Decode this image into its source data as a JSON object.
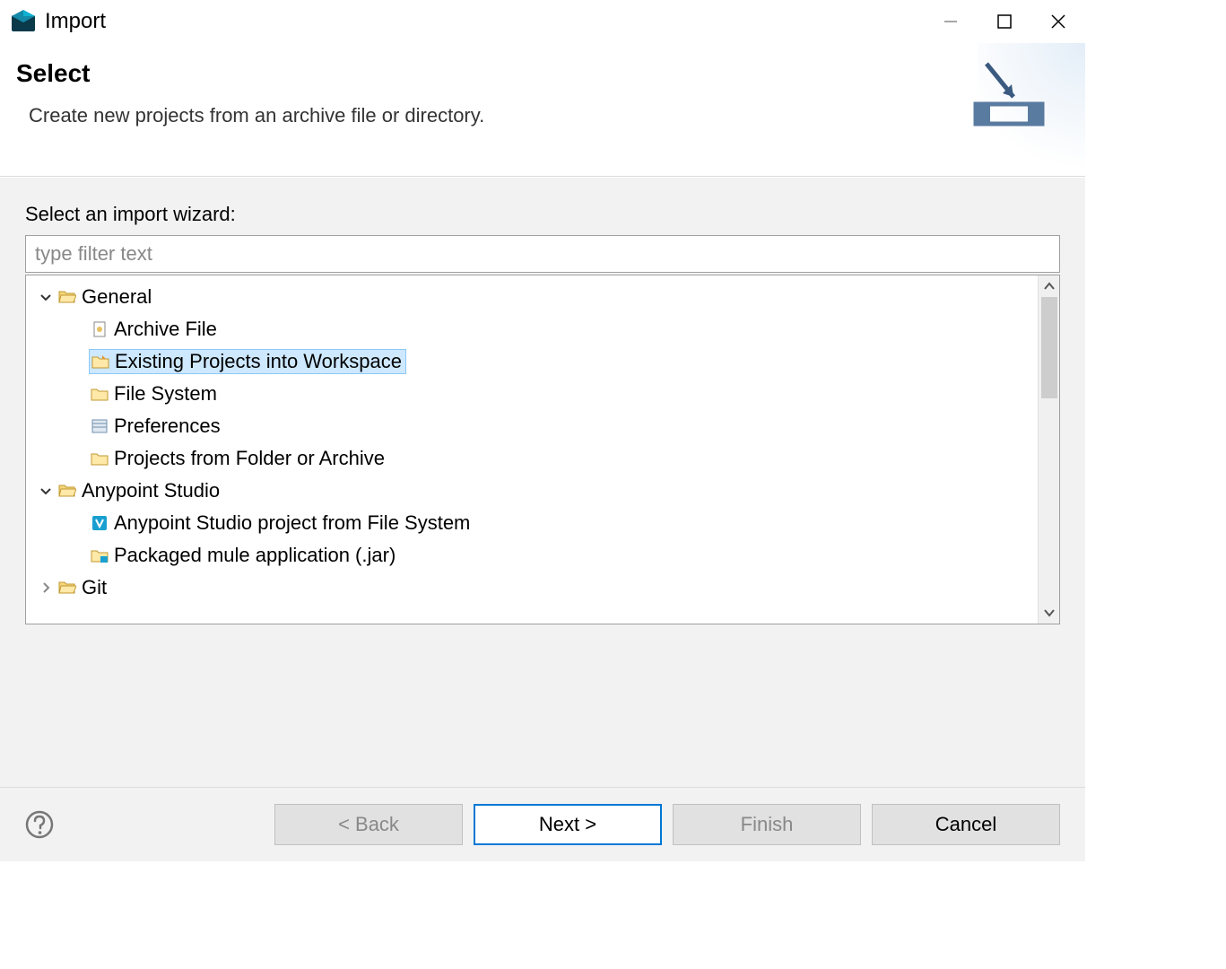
{
  "window": {
    "title": "Import"
  },
  "header": {
    "title": "Select",
    "subtitle": "Create new projects from an archive file or directory."
  },
  "wizard": {
    "label": "Select an import wizard:",
    "filter_placeholder": "type filter text"
  },
  "tree": {
    "groups": [
      {
        "label": "General",
        "expanded": true,
        "items": [
          {
            "label": "Archive File",
            "icon": "archive-file",
            "selected": false
          },
          {
            "label": "Existing Projects into Workspace",
            "icon": "import-folder",
            "selected": true
          },
          {
            "label": "File System",
            "icon": "folder",
            "selected": false
          },
          {
            "label": "Preferences",
            "icon": "preferences",
            "selected": false
          },
          {
            "label": "Projects from Folder or Archive",
            "icon": "folder",
            "selected": false
          }
        ]
      },
      {
        "label": "Anypoint Studio",
        "expanded": true,
        "items": [
          {
            "label": "Anypoint Studio project from File System",
            "icon": "anypoint",
            "selected": false
          },
          {
            "label": "Packaged mule application (.jar)",
            "icon": "package",
            "selected": false
          }
        ]
      },
      {
        "label": "Git",
        "expanded": false,
        "items": []
      }
    ]
  },
  "buttons": {
    "back": "< Back",
    "next": "Next >",
    "finish": "Finish",
    "cancel": "Cancel"
  }
}
